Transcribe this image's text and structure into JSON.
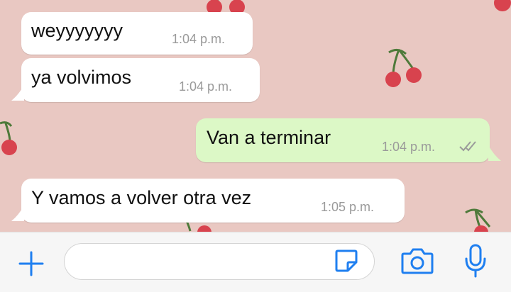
{
  "messages": [
    {
      "direction": "incoming",
      "text": "weyyyyyyy",
      "time": "1:04 p.m."
    },
    {
      "direction": "incoming",
      "text": "ya volvimos",
      "time": "1:04 p.m."
    },
    {
      "direction": "outgoing",
      "text": "Van a terminar",
      "time": "1:04 p.m.",
      "status": "read"
    },
    {
      "direction": "incoming",
      "text": "Y vamos a volver otra vez",
      "time": "1:05 p.m."
    }
  ],
  "composer": {
    "message_value": "",
    "icons": [
      "plus-icon",
      "sticker-icon",
      "camera-icon",
      "microphone-icon"
    ]
  },
  "colors": {
    "wallpaper": "#e9c8c2",
    "incoming_bubble": "#ffffff",
    "outgoing_bubble": "#dcf8c6",
    "accent": "#1f7ff0",
    "cherry": "#d8434e"
  }
}
